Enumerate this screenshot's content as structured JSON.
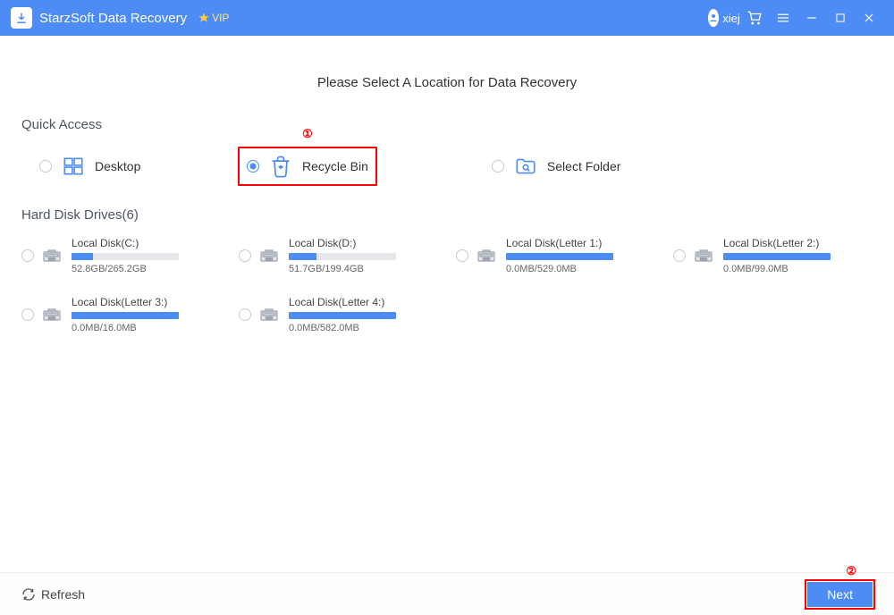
{
  "titlebar": {
    "app_name": "StarzSoft Data Recovery",
    "vip_label": "VIP",
    "username": "xiej"
  },
  "main": {
    "heading": "Please Select A Location for Data Recovery",
    "quick_access_label": "Quick Access",
    "quick_items": [
      {
        "label": "Desktop",
        "icon": "windows-icon",
        "selected": false
      },
      {
        "label": "Recycle Bin",
        "icon": "recycle-bin-icon",
        "selected": true
      },
      {
        "label": "Select Folder",
        "icon": "folder-search-icon",
        "selected": false
      }
    ],
    "drives_label": "Hard Disk Drives(6)",
    "drives": [
      {
        "name": "Local Disk(C:)",
        "used": "52.8GB",
        "total": "265.2GB",
        "fill": 20
      },
      {
        "name": "Local Disk(D:)",
        "used": "51.7GB",
        "total": "199.4GB",
        "fill": 26
      },
      {
        "name": "Local Disk(Letter 1:)",
        "used": "0.0MB",
        "total": "529.0MB",
        "fill": 100
      },
      {
        "name": "Local Disk(Letter 2:)",
        "used": "0.0MB",
        "total": "99.0MB",
        "fill": 100
      },
      {
        "name": "Local Disk(Letter 3:)",
        "used": "0.0MB",
        "total": "16.0MB",
        "fill": 100
      },
      {
        "name": "Local Disk(Letter 4:)",
        "used": "0.0MB",
        "total": "582.0MB",
        "fill": 100
      }
    ]
  },
  "footer": {
    "refresh_label": "Refresh",
    "next_label": "Next"
  },
  "annotations": {
    "one": "①",
    "two": "②"
  }
}
